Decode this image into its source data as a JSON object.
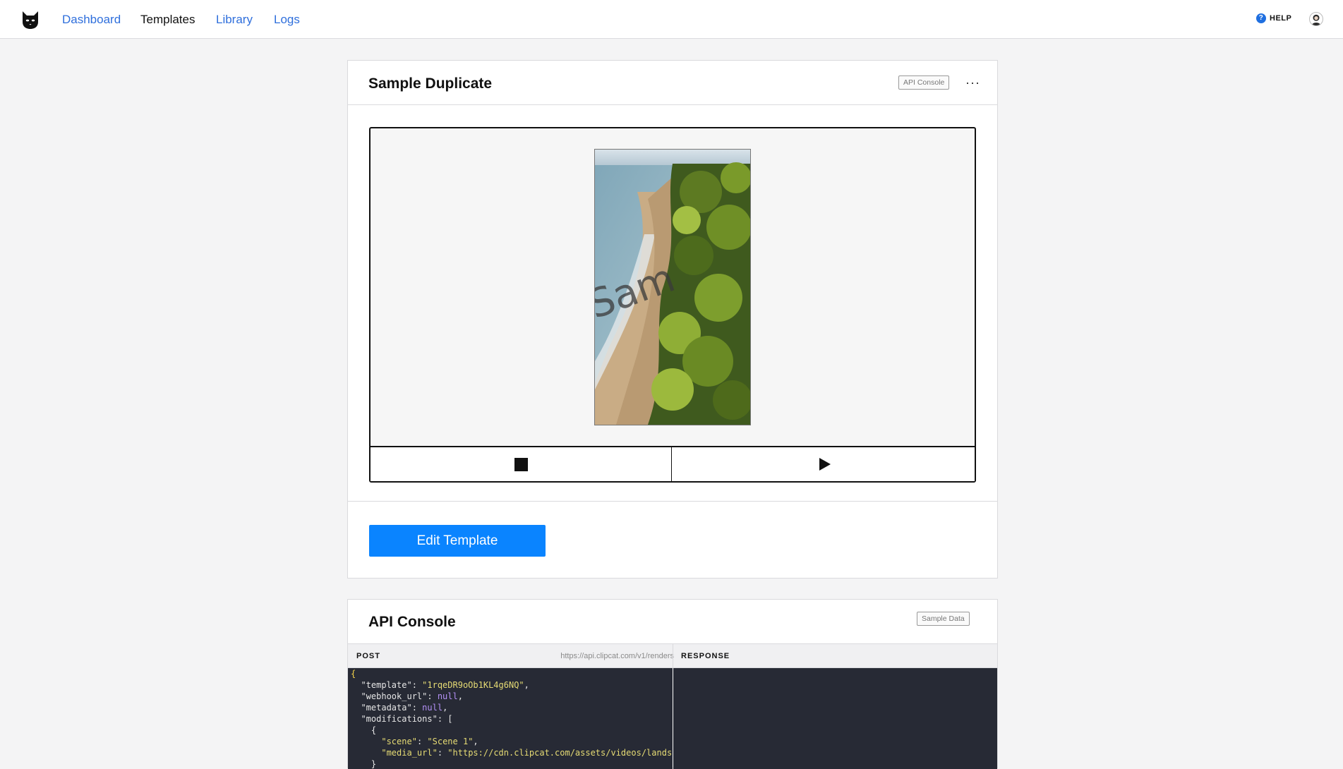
{
  "nav": {
    "items": [
      {
        "label": "Dashboard",
        "active": false
      },
      {
        "label": "Templates",
        "active": true
      },
      {
        "label": "Library",
        "active": false
      },
      {
        "label": "Logs",
        "active": false
      }
    ],
    "help_label": "HELP",
    "help_icon": "question-circle-icon",
    "accent_color": "#2f6fdc"
  },
  "template_card": {
    "title": "Sample Duplicate",
    "api_console_button": "API Console",
    "more_label": "···",
    "preview": {
      "watermark_text": "Sam",
      "stop_icon": "stop-icon",
      "play_icon": "play-icon"
    },
    "edit_button": "Edit Template",
    "edit_button_color": "#0a84ff"
  },
  "api_console": {
    "title": "API Console",
    "sample_data_button": "Sample Data",
    "request_label": "POST",
    "endpoint": "https://api.clipcat.com/v1/renders",
    "response_label": "RESPONSE",
    "request_body": {
      "open": "{",
      "template_key": "\"template\"",
      "template_value": "\"1rqeDR9oOb1KL4g6NQ\"",
      "webhook_key": "\"webhook_url\"",
      "webhook_value": "null",
      "metadata_key": "\"metadata\"",
      "metadata_value": "null",
      "modifications_key": "\"modifications\"",
      "array_open": "[",
      "object_open": "{",
      "scene_key": "\"scene\"",
      "scene_value": "\"Scene 1\"",
      "media_key": "\"media_url\"",
      "media_value": "\"https://cdn.clipcat.com/assets/videos/landscape\"",
      "object_close": "}"
    }
  }
}
